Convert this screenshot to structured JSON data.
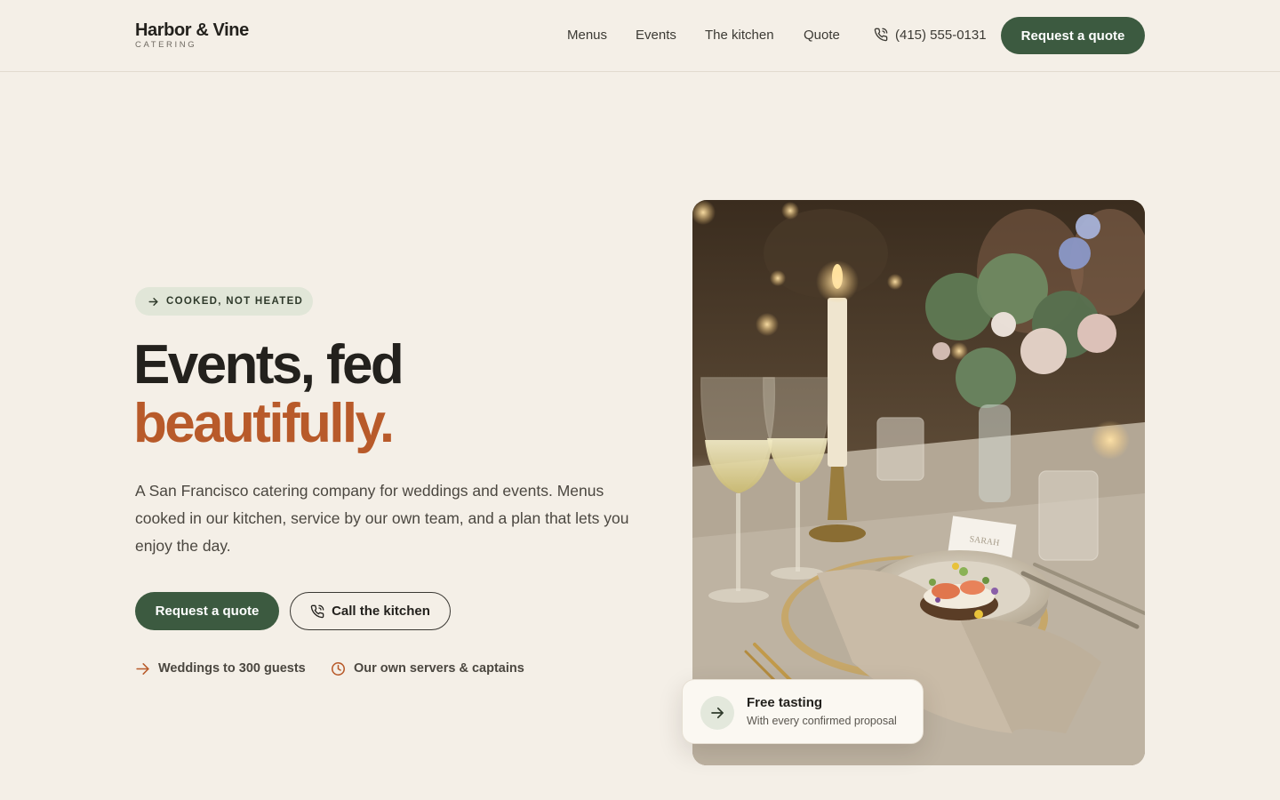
{
  "header": {
    "brand_name": "Harbor & Vine",
    "brand_sub": "CATERING",
    "nav": [
      {
        "label": "Menus"
      },
      {
        "label": "Events"
      },
      {
        "label": "The kitchen"
      },
      {
        "label": "Quote"
      }
    ],
    "phone": "(415) 555-0131",
    "cta": "Request a quote"
  },
  "hero": {
    "badge": "COOKED, NOT HEATED",
    "headline_line1": "Events, fed",
    "headline_line2": "beautifully.",
    "lede": "A San Francisco catering company for weddings and events. Menus cooked in our kitchen, service by our own team, and a plan that lets you enjoy the day.",
    "primary_cta": "Request a quote",
    "secondary_cta": "Call the kitchen",
    "features": [
      {
        "label": "Weddings to 300 guests",
        "icon": "arrow-right-icon"
      },
      {
        "label": "Our own servers & captains",
        "icon": "clock-icon"
      }
    ],
    "image_place_card": "SARAH"
  },
  "tasting_card": {
    "title": "Free tasting",
    "subtitle": "With every confirmed proposal",
    "icon": "arrow-right-icon"
  },
  "colors": {
    "background": "#f4efe7",
    "primary_green": "#3c5a40",
    "accent_rust": "#b85a2a",
    "badge_bg": "#e1e6d8"
  }
}
